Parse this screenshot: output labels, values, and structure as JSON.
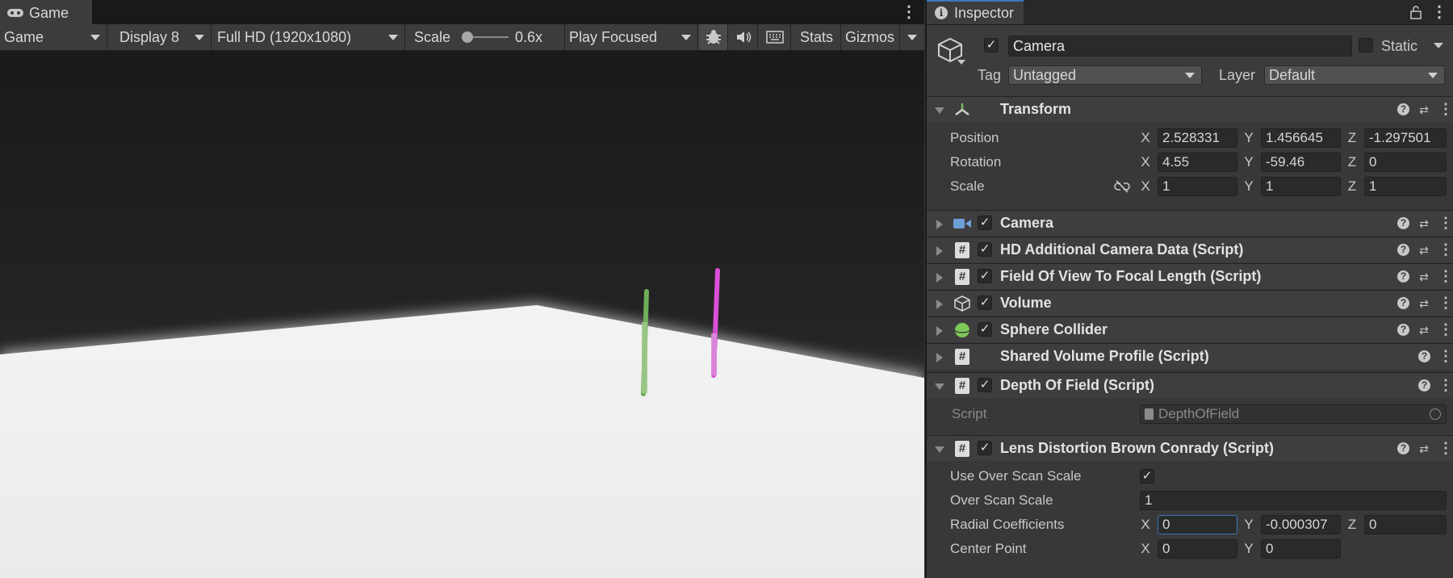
{
  "game": {
    "tab_label": "Game",
    "toolbar": {
      "mode": "Game",
      "display": "Display 8",
      "resolution": "Full HD (1920x1080)",
      "scale_label": "Scale",
      "scale_value": "0.6x",
      "play_mode": "Play Focused",
      "stats_label": "Stats",
      "gizmos_label": "Gizmos"
    }
  },
  "inspector": {
    "tab_label": "Inspector",
    "object": {
      "name": "Camera",
      "static_label": "Static",
      "tag_label": "Tag",
      "tag_value": "Untagged",
      "layer_label": "Layer",
      "layer_value": "Default"
    },
    "transform": {
      "title": "Transform",
      "position_label": "Position",
      "rotation_label": "Rotation",
      "scale_label": "Scale",
      "x": "X",
      "y": "Y",
      "z": "Z",
      "position": [
        "2.528331",
        "1.456645",
        "-1.297501"
      ],
      "rotation": [
        "4.55",
        "-59.46",
        "0"
      ],
      "scale": [
        "1",
        "1",
        "1"
      ]
    },
    "components": [
      {
        "title": "Camera"
      },
      {
        "title": "HD Additional Camera Data (Script)"
      },
      {
        "title": "Field Of View To Focal Length (Script)"
      },
      {
        "title": "Volume"
      },
      {
        "title": "Sphere Collider"
      },
      {
        "title": "Shared Volume Profile (Script)"
      }
    ],
    "dof": {
      "title": "Depth Of Field (Script)",
      "script_label": "Script",
      "script_value": "DepthOfField"
    },
    "lens": {
      "title": "Lens Distortion Brown Conrady (Script)",
      "use_over_scan_label": "Use Over Scan Scale",
      "over_scan_label": "Over Scan Scale",
      "over_scan_value": "1",
      "radial_label": "Radial Coefficients",
      "radial": [
        "0",
        "-0.000307",
        "0"
      ],
      "center_label": "Center Point",
      "center": [
        "0",
        "0"
      ],
      "x": "X",
      "y": "Y",
      "z": "Z"
    }
  },
  "colors": {
    "accent": "#3a79bb",
    "green_line": "#6fae5a",
    "magenta_line": "#d94fd8"
  }
}
